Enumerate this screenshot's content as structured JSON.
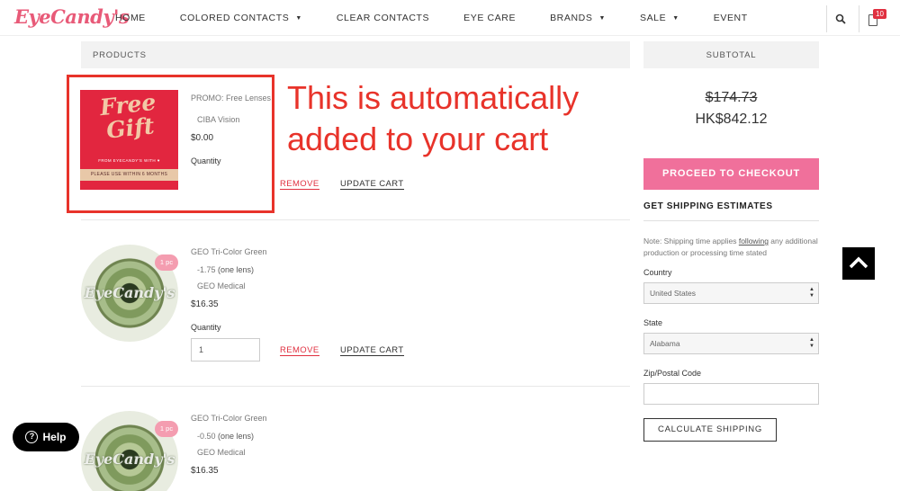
{
  "header": {
    "logo": "EyeCandy's",
    "nav": [
      {
        "label": "HOME",
        "caret": false
      },
      {
        "label": "COLORED CONTACTS",
        "caret": true
      },
      {
        "label": "CLEAR CONTACTS",
        "caret": false
      },
      {
        "label": "EYE CARE",
        "caret": false
      },
      {
        "label": "BRANDS",
        "caret": true
      },
      {
        "label": "SALE",
        "caret": true
      },
      {
        "label": "EVENT",
        "caret": false
      }
    ],
    "cart_count": "10",
    "icons": [
      "search-icon",
      "cart-icon"
    ]
  },
  "products": {
    "header": "PRODUCTS",
    "items": [
      {
        "image_text": {
          "title": "Free Gift",
          "sub": "FROM EYECANDY'S WITH",
          "band": "PLEASE USE WITHIN 6 MONTHS"
        },
        "name": "PROMO: Free Lenses",
        "brand": "CIBA Vision",
        "price": "$0.00",
        "quantity_label": "Quantity",
        "remove": "REMOVE",
        "update": "UPDATE CART"
      },
      {
        "image_logo": "EyeCandy's",
        "badge": "1 pc",
        "name": "GEO Tri-Color Green",
        "power": "-1.75",
        "lens_note": "(one lens)",
        "brand": "GEO Medical",
        "price": "$16.35",
        "quantity_label": "Quantity",
        "quantity": "1",
        "remove": "REMOVE",
        "update": "UPDATE CART"
      },
      {
        "image_logo": "EyeCandy's",
        "badge": "1 pc",
        "name": "GEO Tri-Color Green",
        "power": "-0.50",
        "lens_note": "(one lens)",
        "brand": "GEO Medical",
        "price": "$16.35"
      }
    ]
  },
  "annotation": {
    "text": "This is automatically added to your cart",
    "color": "#e8332a"
  },
  "subtotal": {
    "header": "SUBTOTAL",
    "original": "$174.73",
    "total": "HK$842.12",
    "checkout": "PROCEED TO CHECKOUT"
  },
  "shipping": {
    "title": "GET SHIPPING ESTIMATES",
    "note_prefix": "Note: Shipping time applies ",
    "note_link": "following",
    "note_suffix": " any additional production or processing time stated",
    "country_label": "Country",
    "country_value": "United States",
    "state_label": "State",
    "state_value": "Alabama",
    "zip_label": "Zip/Postal Code",
    "zip_value": "",
    "calc_button": "CALCULATE SHIPPING"
  },
  "help": {
    "label": "Help",
    "icon": "question-icon"
  },
  "colors": {
    "brand_pink": "#f0709b",
    "remove_red": "#e03040",
    "annotation_red": "#e8332a"
  }
}
